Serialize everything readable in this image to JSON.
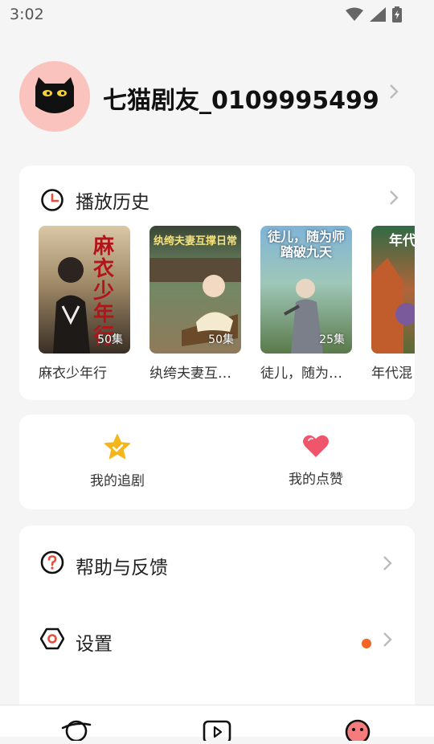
{
  "status_bar": {
    "time": "3:02"
  },
  "profile": {
    "name": "七猫剧友_0109995499"
  },
  "history": {
    "title": "播放历史",
    "items": [
      {
        "title": "麻衣少年行",
        "episodes": "50集",
        "cover_text": "麻衣少年行"
      },
      {
        "title": "纨绔夫妻互…",
        "episodes": "50集",
        "cover_text": "纨绔夫妻互撑日常"
      },
      {
        "title": "徒儿，随为…",
        "episodes": "25集",
        "cover_text": "徒儿，随为师踏破九天"
      },
      {
        "title": "年代混",
        "episodes": "",
        "cover_text": "年代"
      }
    ]
  },
  "quick_actions": [
    {
      "label": "我的追剧",
      "icon": "star-icon"
    },
    {
      "label": "我的点赞",
      "icon": "heart-icon"
    }
  ],
  "menu": [
    {
      "label": "帮助与反馈",
      "icon": "help-icon",
      "has_dot": false
    },
    {
      "label": "设置",
      "icon": "settings-icon",
      "has_dot": true
    }
  ],
  "colors": {
    "accent": "#f26522",
    "star": "#f5b61a",
    "heart": "#f0566b",
    "avatar_bg": "#fbc3bd"
  }
}
